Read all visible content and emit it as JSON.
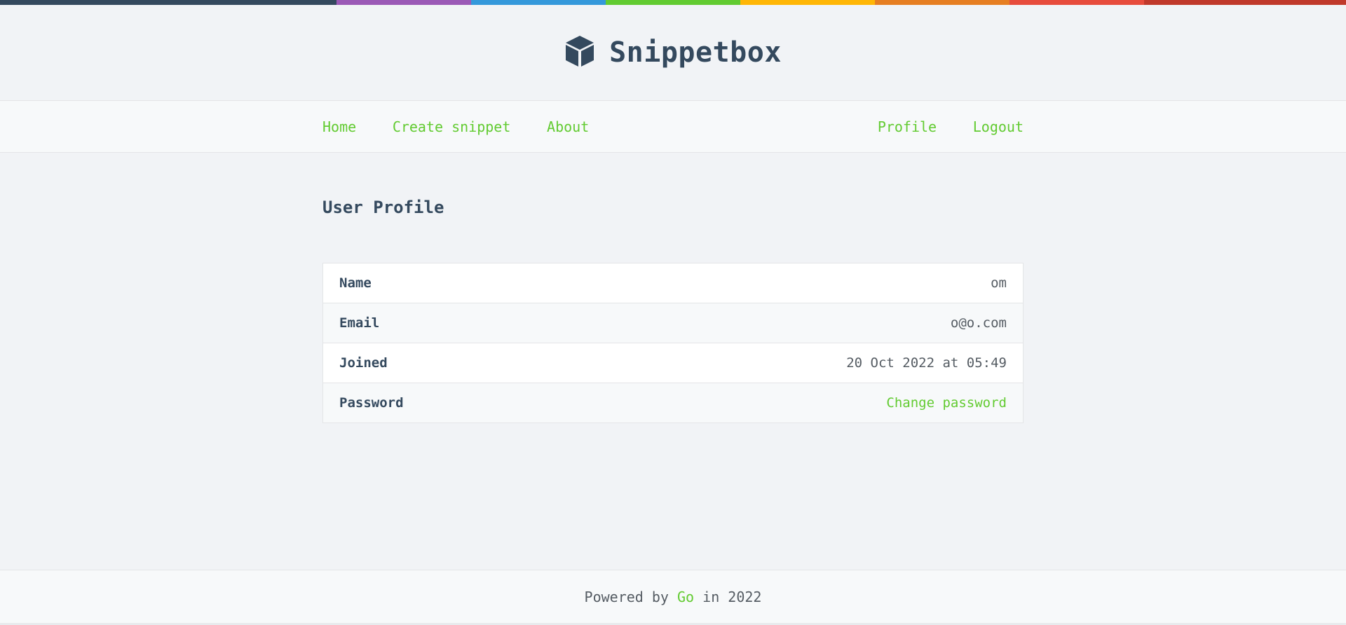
{
  "brand": {
    "name": "Snippetbox",
    "logo_icon": "cube-icon"
  },
  "colors": {
    "accent": "#62cb31",
    "text": "#34495e",
    "rainbow": [
      "#34495e",
      "#9b59b6",
      "#3498db",
      "#62cb31",
      "#ffb606",
      "#e67e22",
      "#e74c3c",
      "#c0392b"
    ]
  },
  "nav": {
    "left": [
      {
        "label": "Home"
      },
      {
        "label": "Create snippet"
      },
      {
        "label": "About"
      }
    ],
    "right": [
      {
        "label": "Profile"
      },
      {
        "label": "Logout"
      }
    ]
  },
  "page": {
    "title": "User Profile"
  },
  "profile": {
    "rows": [
      {
        "key": "Name",
        "value": "om"
      },
      {
        "key": "Email",
        "value": "o@o.com"
      },
      {
        "key": "Joined",
        "value": "20 Oct 2022 at 05:49"
      },
      {
        "key": "Password",
        "value": "Change password"
      }
    ]
  },
  "footer": {
    "prefix": "Powered by",
    "link": "Go",
    "suffix": "in 2022"
  }
}
